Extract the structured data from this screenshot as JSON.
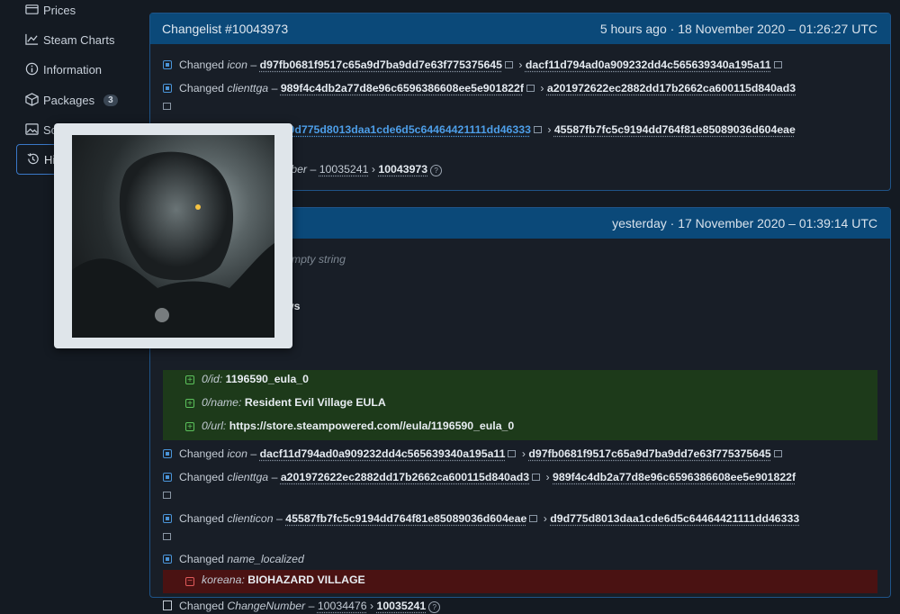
{
  "sidebar": {
    "items": [
      {
        "label": "Prices",
        "icon": "prices-icon"
      },
      {
        "label": "Steam Charts",
        "icon": "chart-icon"
      },
      {
        "label": "Information",
        "icon": "info-icon"
      },
      {
        "label": "Packages",
        "icon": "package-icon",
        "badge": "3"
      },
      {
        "label": "Sc",
        "icon": "image-icon"
      },
      {
        "label": "Hi",
        "icon": "history-icon",
        "active": true
      }
    ]
  },
  "changelist1": {
    "title": "Changelist #10043973",
    "time": "5 hours ago · 18 November 2020 – 01:26:27 UTC",
    "row1": {
      "prefix": "Changed",
      "key": "icon",
      "from": "d97fb0681f9517c65a9d7ba9dd7e63f775375645",
      "to": "dacf11d794ad0a909232dd4c565639340a195a11"
    },
    "row2": {
      "prefix": "Changed",
      "key": "clienttga",
      "from": "989f4c4db2a77d8e96c6596386608ee5e901822f",
      "to": "a201972622ec2882dd17b2662ca600115d840ad3"
    },
    "row3": {
      "from": "d9d775d8013daa1cde6d5c64464421111dd46333",
      "to": "45587fb7fc5c9194dd764f81e85089036d604eae"
    },
    "row4": {
      "key_fragment": "mber",
      "from": "10035241",
      "to": "10043973"
    }
  },
  "changelist2": {
    "time": "yesterday · 17 November 2020 – 01:39:14 UTC",
    "empty_text": "empty string",
    "ws_text": "ws",
    "added": [
      {
        "key": "0/id:",
        "value": "1196590_eula_0"
      },
      {
        "key": "0/name:",
        "value": "Resident Evil Village EULA"
      },
      {
        "key": "0/url:",
        "value": "https://store.steampowered.com//eula/1196590_eula_0"
      }
    ],
    "row_icon": {
      "prefix": "Changed",
      "key": "icon",
      "from": "dacf11d794ad0a909232dd4c565639340a195a11",
      "to": "d97fb0681f9517c65a9d7ba9dd7e63f775375645"
    },
    "row_clienttga": {
      "prefix": "Changed",
      "key": "clienttga",
      "from": "a201972622ec2882dd17b2662ca600115d840ad3",
      "to": "989f4c4db2a77d8e96c6596386608ee5e901822f"
    },
    "row_clienticon": {
      "prefix": "Changed",
      "key": "clienticon",
      "from": "45587fb7fc5c9194dd764f81e85089036d604eae",
      "to": "d9d775d8013daa1cde6d5c64464421111dd46333"
    },
    "row_name_localized": {
      "prefix": "Changed",
      "key": "name_localized"
    },
    "removed": {
      "key": "koreana:",
      "value": "BIOHAZARD VILLAGE"
    },
    "row_changenumber": {
      "prefix": "Changed",
      "key": "ChangeNumber",
      "from": "10034476",
      "to": "10035241"
    }
  },
  "colors": {
    "accent": "#0b4979",
    "added_bg": "#1d3a1a",
    "removed_bg": "#4a1212",
    "link": "#4d9ee8"
  }
}
